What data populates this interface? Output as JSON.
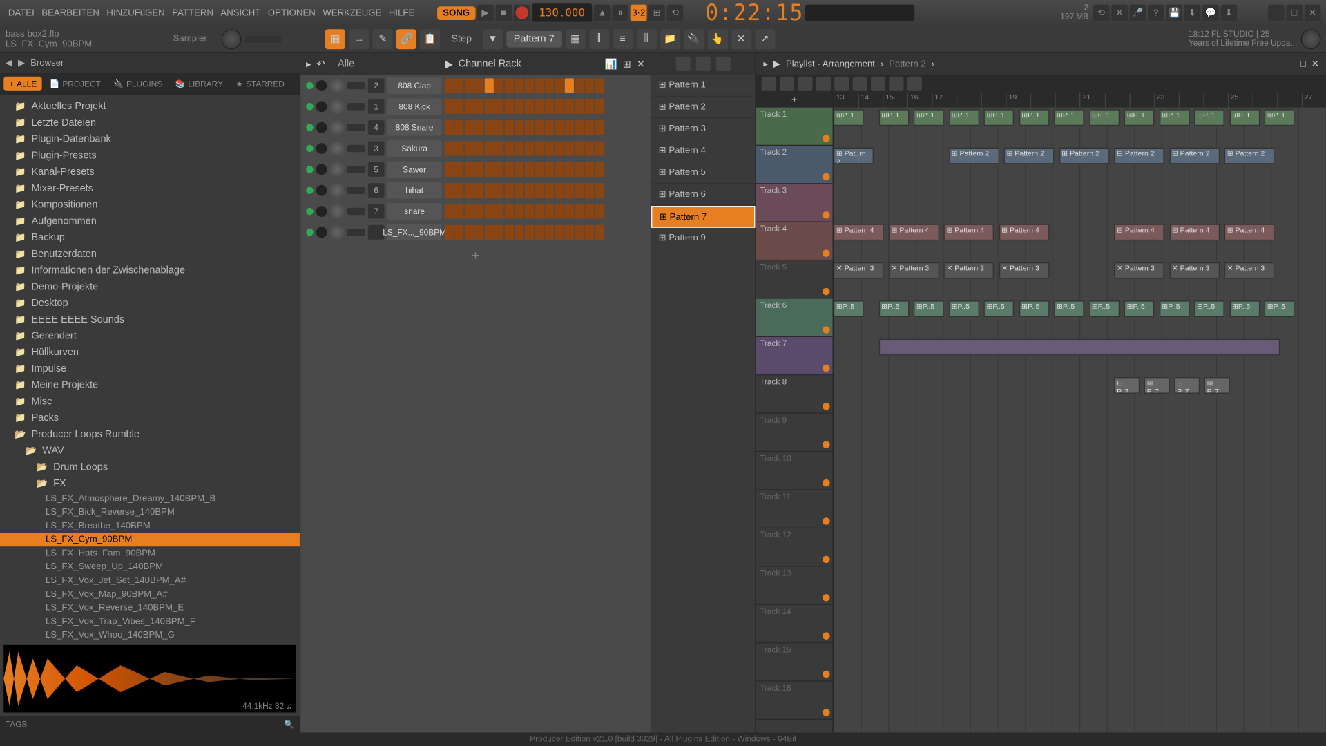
{
  "menu": {
    "items": [
      "DATEI",
      "BEARBEITEN",
      "HINZUFüGEN",
      "PATTERN",
      "ANSICHT",
      "OPTIONEN",
      "WERKZEUGE",
      "HILFE"
    ],
    "song": "SONG",
    "tempo": "130.000",
    "timer": "0:22:15",
    "cpu_pct": "2",
    "mem": "197 MB",
    "time": "18:12"
  },
  "toolbar": {
    "file1": "bass box2.flp",
    "file2": "LS_FX_Cym_90BPM",
    "sampler": "Sampler",
    "step": "Step",
    "pattern": "Pattern 7",
    "info1": "FL STUDIO | 25",
    "info2": "Years of Lifetime Free Upda..."
  },
  "browser": {
    "title": "Browser",
    "tabs": [
      "ALLE",
      "PROJECT",
      "PLUGINS",
      "LIBRARY",
      "STARRED"
    ],
    "tree": [
      "Aktuelles Projekt",
      "Letzte Dateien",
      "Plugin-Datenbank",
      "Plugin-Presets",
      "Kanal-Presets",
      "Mixer-Presets",
      "Kompositionen",
      "Aufgenommen",
      "Backup",
      "Benutzerdaten",
      "Informationen der Zwischenablage",
      "Demo-Projekte",
      "Desktop",
      "EEEE EEEE Sounds",
      "Gerendert",
      "Hüllkurven",
      "Impulse",
      "Meine Projekte",
      "Misc",
      "Packs",
      "Producer Loops Rumble"
    ],
    "sub1": "WAV",
    "sub2": "Drum Loops",
    "sub3": "FX",
    "files": [
      "LS_FX_Atmosphere_Dreamy_140BPM_B",
      "LS_FX_Bick_Reverse_140BPM",
      "LS_FX_Breathe_140BPM",
      "LS_FX_Cym_90BPM",
      "LS_FX_Hats_Fam_90BPM",
      "LS_FX_Sweep_Up_140BPM",
      "LS_FX_Vox_Jet_Set_140BPM_A#",
      "LS_FX_Vox_Map_90BPM_A#",
      "LS_FX_Vox_Reverse_140BPM_E",
      "LS_FX_Vox_Trap_Vibes_140BPM_F",
      "LS_FX_Vox_Whoo_140BPM_G"
    ],
    "selected_file": 3,
    "wave_info": "44.1kHz 32 ♫",
    "tags": "TAGS"
  },
  "channelrack": {
    "title": "Channel Rack",
    "filter": "Alle",
    "channels": [
      {
        "num": "2",
        "name": "808 Clap",
        "steps": [
          0,
          0,
          0,
          0,
          1,
          0,
          0,
          0,
          0,
          0,
          0,
          0,
          1,
          0,
          0,
          0
        ]
      },
      {
        "num": "1",
        "name": "808 Kick",
        "steps": [
          0,
          0,
          0,
          0,
          0,
          0,
          0,
          0,
          0,
          0,
          0,
          0,
          0,
          0,
          0,
          0
        ]
      },
      {
        "num": "4",
        "name": "808 Snare",
        "steps": [
          0,
          0,
          0,
          0,
          0,
          0,
          0,
          0,
          0,
          0,
          0,
          0,
          0,
          0,
          0,
          0
        ]
      },
      {
        "num": "3",
        "name": "Sakura",
        "steps": [
          0,
          0,
          0,
          0,
          0,
          0,
          0,
          0,
          0,
          0,
          0,
          0,
          0,
          0,
          0,
          0
        ]
      },
      {
        "num": "5",
        "name": "Sawer",
        "steps": [
          0,
          0,
          0,
          0,
          0,
          0,
          0,
          0,
          0,
          0,
          0,
          0,
          0,
          0,
          0,
          0
        ]
      },
      {
        "num": "6",
        "name": "hihat",
        "steps": [
          0,
          0,
          0,
          0,
          0,
          0,
          0,
          0,
          0,
          0,
          0,
          0,
          0,
          0,
          0,
          0
        ]
      },
      {
        "num": "7",
        "name": "snare",
        "steps": [
          0,
          0,
          0,
          0,
          0,
          0,
          0,
          0,
          0,
          0,
          0,
          0,
          0,
          0,
          0,
          0
        ]
      },
      {
        "num": "--",
        "name": "LS_FX..._90BPM",
        "steps": [
          0,
          0,
          0,
          0,
          0,
          0,
          0,
          0,
          0,
          0,
          0,
          0,
          0,
          0,
          0,
          0
        ]
      }
    ]
  },
  "patterns": [
    "Pattern 1",
    "Pattern 2",
    "Pattern 3",
    "Pattern 4",
    "Pattern 5",
    "Pattern 6",
    "Pattern 7",
    "Pattern 9"
  ],
  "pattern_selected": 6,
  "playlist": {
    "title": "Playlist - Arrangement",
    "crumb": "Pattern 2",
    "ruler": [
      "13",
      "14",
      "15",
      "16",
      "17",
      "",
      "",
      "19",
      "",
      "",
      "21",
      "",
      "",
      "23",
      "",
      "",
      "25",
      "",
      "",
      "27"
    ],
    "tracks": [
      {
        "name": "Track 1",
        "cls": "c1",
        "clips": [
          {
            "l": 0,
            "w": 6,
            "t": "⊞P..1"
          },
          {
            "l": 9,
            "w": 6,
            "t": "⊞P..1"
          },
          {
            "l": 16,
            "w": 6,
            "t": "⊞P..1"
          },
          {
            "l": 23,
            "w": 6,
            "t": "⊞P..1"
          },
          {
            "l": 30,
            "w": 6,
            "t": "⊞P..1"
          },
          {
            "l": 37,
            "w": 6,
            "t": "⊞P..1"
          },
          {
            "l": 44,
            "w": 6,
            "t": "⊞P..1"
          },
          {
            "l": 51,
            "w": 6,
            "t": "⊞P..1"
          },
          {
            "l": 58,
            "w": 6,
            "t": "⊞P..1"
          },
          {
            "l": 65,
            "w": 6,
            "t": "⊞P..1"
          },
          {
            "l": 72,
            "w": 6,
            "t": "⊞P..1"
          },
          {
            "l": 79,
            "w": 6,
            "t": "⊞P..1"
          },
          {
            "l": 86,
            "w": 6,
            "t": "⊞P..1"
          }
        ]
      },
      {
        "name": "Track 2",
        "cls": "c2",
        "clips": [
          {
            "l": 0,
            "w": 8,
            "t": "⊞ Pat..rn 2"
          },
          {
            "l": 23,
            "w": 10,
            "t": "⊞ Pattern 2"
          },
          {
            "l": 34,
            "w": 10,
            "t": "⊞ Pattern 2"
          },
          {
            "l": 45,
            "w": 10,
            "t": "⊞ Pattern 2"
          },
          {
            "l": 56,
            "w": 10,
            "t": "⊞ Pattern 2"
          },
          {
            "l": 67,
            "w": 10,
            "t": "⊞ Pattern 2"
          },
          {
            "l": 78,
            "w": 10,
            "t": "⊞ Pattern 2"
          }
        ]
      },
      {
        "name": "Track 3",
        "cls": "c3",
        "clips": []
      },
      {
        "name": "Track 4",
        "cls": "c4",
        "clips": [
          {
            "l": 0,
            "w": 10,
            "t": "⊞ Pattern 4"
          },
          {
            "l": 11,
            "w": 10,
            "t": "⊞ Pattern 4"
          },
          {
            "l": 22,
            "w": 10,
            "t": "⊞ Pattern 4"
          },
          {
            "l": 33,
            "w": 10,
            "t": "⊞ Pattern 4"
          },
          {
            "l": 56,
            "w": 10,
            "t": "⊞ Pattern 4"
          },
          {
            "l": 67,
            "w": 10,
            "t": "⊞ Pattern 4"
          },
          {
            "l": 78,
            "w": 10,
            "t": "⊞ Pattern 4"
          }
        ]
      },
      {
        "name": "Track 5",
        "cls": "dim",
        "clips": [
          {
            "l": 0,
            "w": 10,
            "t": "✕ Pattern 3",
            "c": "c5"
          },
          {
            "l": 11,
            "w": 10,
            "t": "✕ Pattern 3",
            "c": "c5"
          },
          {
            "l": 22,
            "w": 10,
            "t": "✕ Pattern 3",
            "c": "c5"
          },
          {
            "l": 33,
            "w": 10,
            "t": "✕ Pattern 3",
            "c": "c5"
          },
          {
            "l": 56,
            "w": 10,
            "t": "✕ Pattern 3",
            "c": "c5"
          },
          {
            "l": 67,
            "w": 10,
            "t": "✕ Pattern 3",
            "c": "c5"
          },
          {
            "l": 78,
            "w": 10,
            "t": "✕ Pattern 3",
            "c": "c5"
          }
        ]
      },
      {
        "name": "Track 6",
        "cls": "c6",
        "clips": [
          {
            "l": 0,
            "w": 6,
            "t": "⊞P..5"
          },
          {
            "l": 9,
            "w": 6,
            "t": "⊞P..5"
          },
          {
            "l": 16,
            "w": 6,
            "t": "⊞P..5"
          },
          {
            "l": 23,
            "w": 6,
            "t": "⊞P..5"
          },
          {
            "l": 30,
            "w": 6,
            "t": "⊞P..5"
          },
          {
            "l": 37,
            "w": 6,
            "t": "⊞P..5"
          },
          {
            "l": 44,
            "w": 6,
            "t": "⊞P..5"
          },
          {
            "l": 51,
            "w": 6,
            "t": "⊞P..5"
          },
          {
            "l": 58,
            "w": 6,
            "t": "⊞P..5"
          },
          {
            "l": 65,
            "w": 6,
            "t": "⊞P..5"
          },
          {
            "l": 72,
            "w": 6,
            "t": "⊞P..5"
          },
          {
            "l": 79,
            "w": 6,
            "t": "⊞P..5"
          },
          {
            "l": 86,
            "w": 6,
            "t": "⊞P..5"
          }
        ]
      },
      {
        "name": "Track 7",
        "cls": "c7",
        "clips": [
          {
            "l": 9,
            "w": 80,
            "t": ""
          }
        ]
      },
      {
        "name": "Track 8",
        "cls": "",
        "clips": [
          {
            "l": 56,
            "w": 5,
            "t": "⊞ P..7",
            "c": "c8"
          },
          {
            "l": 62,
            "w": 5,
            "t": "⊞ P..7",
            "c": "c8"
          },
          {
            "l": 68,
            "w": 5,
            "t": "⊞ P..7",
            "c": "c8"
          },
          {
            "l": 74,
            "w": 5,
            "t": "⊞ P..7",
            "c": "c8"
          }
        ]
      },
      {
        "name": "Track 9",
        "cls": "dim",
        "clips": []
      },
      {
        "name": "Track 10",
        "cls": "dim",
        "clips": []
      },
      {
        "name": "Track 11",
        "cls": "dim",
        "clips": []
      },
      {
        "name": "Track 12",
        "cls": "dim",
        "clips": []
      },
      {
        "name": "Track 13",
        "cls": "dim",
        "clips": []
      },
      {
        "name": "Track 14",
        "cls": "dim",
        "clips": []
      },
      {
        "name": "Track 15",
        "cls": "dim",
        "clips": []
      },
      {
        "name": "Track 16",
        "cls": "dim",
        "clips": []
      }
    ]
  },
  "footer": "Producer Edition v21.0 [build 3329] - All Plugins Edition - Windows - 64Bit"
}
